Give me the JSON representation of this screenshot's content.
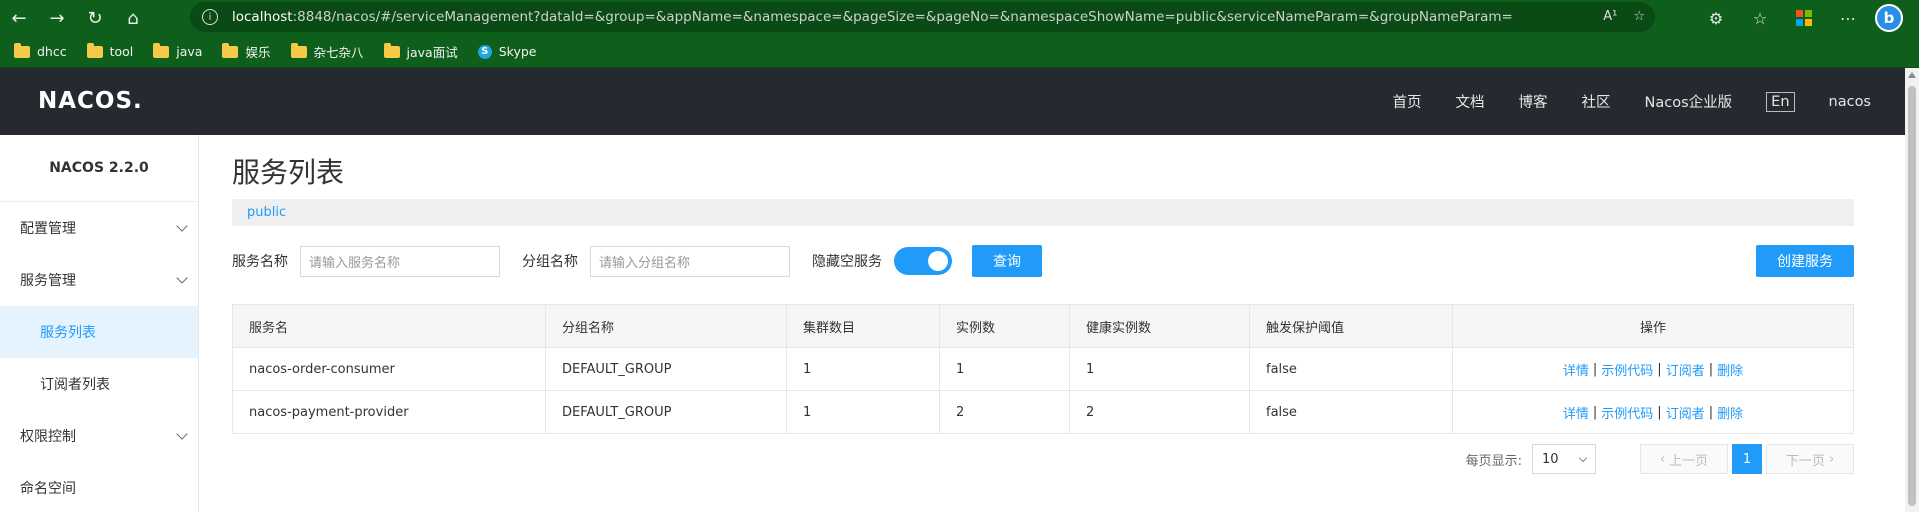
{
  "browser": {
    "url_host": "localhost",
    "url_rest": ":8848/nacos/#/serviceManagement?dataId=&group=&appName=&namespace=&pageSize=&pageNo=&namespaceShowName=public&serviceNameParam=&groupNameParam=",
    "read_aloud": "A¹",
    "bookmarks": [
      {
        "label": "dhcc",
        "icon": "folder-icon"
      },
      {
        "label": "tool",
        "icon": "folder-icon"
      },
      {
        "label": "java",
        "icon": "folder-icon"
      },
      {
        "label": "娱乐",
        "icon": "folder-icon"
      },
      {
        "label": "杂七杂八",
        "icon": "folder-icon"
      },
      {
        "label": "java面试",
        "icon": "folder-icon"
      },
      {
        "label": "Skype",
        "icon": "skype-icon"
      }
    ]
  },
  "header": {
    "logo": "NACOS.",
    "nav": [
      "首页",
      "文档",
      "博客",
      "社区",
      "Nacos企业版"
    ],
    "lang": "En",
    "user": "nacos"
  },
  "sidebar": {
    "title": "NACOS 2.2.0",
    "items": [
      {
        "label": "配置管理"
      },
      {
        "label": "服务管理"
      },
      {
        "label": "服务列表"
      },
      {
        "label": "订阅者列表"
      },
      {
        "label": "权限控制"
      },
      {
        "label": "命名空间"
      }
    ]
  },
  "main": {
    "title": "服务列表",
    "namespace": "public",
    "search": {
      "service_label": "服务名称",
      "service_placeholder": "请输入服务名称",
      "group_label": "分组名称",
      "group_placeholder": "请输入分组名称",
      "hide_empty_label": "隐藏空服务",
      "hide_empty_on": true,
      "query_button": "查询",
      "create_button": "创建服务"
    },
    "table": {
      "columns": [
        "服务名",
        "分组名称",
        "集群数目",
        "实例数",
        "健康实例数",
        "触发保护阈值",
        "操作"
      ],
      "rows": [
        [
          "nacos-order-consumer",
          "DEFAULT_GROUP",
          "1",
          "1",
          "1",
          "false"
        ],
        [
          "nacos-payment-provider",
          "DEFAULT_GROUP",
          "1",
          "2",
          "2",
          "false"
        ]
      ],
      "actions": [
        "详情",
        "示例代码",
        "订阅者",
        "删除"
      ]
    },
    "pager": {
      "page_size_label": "每页显示:",
      "page_size": "10",
      "prev": "上一页",
      "current": "1",
      "next": "下一页"
    }
  },
  "colors": {
    "accent": "#209bfa",
    "header_bg": "#262a30",
    "browser_bg": "#0f5f1c"
  }
}
